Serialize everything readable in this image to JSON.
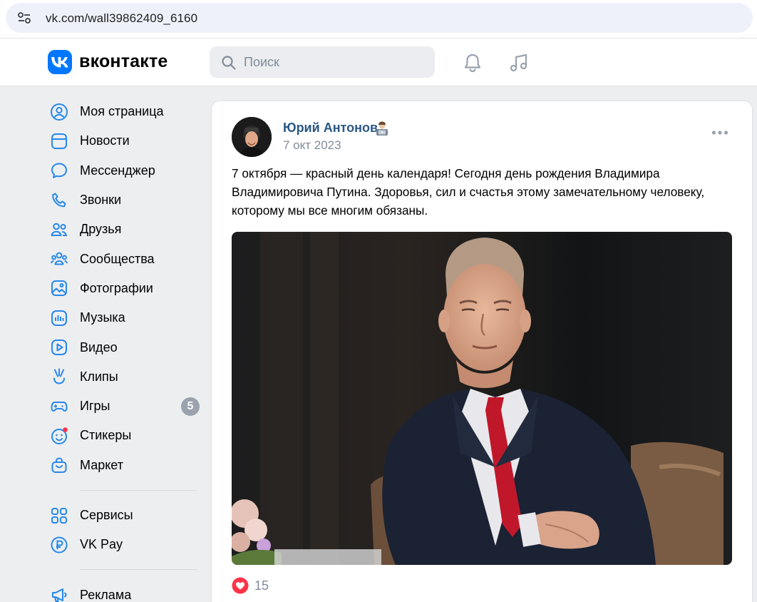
{
  "browser": {
    "url": "vk.com/wall39862409_6160"
  },
  "header": {
    "brand": "вконтакте",
    "search_placeholder": "Поиск",
    "icons": [
      "site-settings-icon",
      "vk-logo-icon",
      "search-icon",
      "bell-icon",
      "music-note-icon"
    ]
  },
  "sidebar": {
    "items": [
      {
        "label": "Моя страница",
        "icon": "user-circle-icon"
      },
      {
        "label": "Новости",
        "icon": "news-icon"
      },
      {
        "label": "Мессенджер",
        "icon": "message-bubble-icon"
      },
      {
        "label": "Звонки",
        "icon": "phone-icon"
      },
      {
        "label": "Друзья",
        "icon": "friends-icon"
      },
      {
        "label": "Сообщества",
        "icon": "communities-icon"
      },
      {
        "label": "Фотографии",
        "icon": "photo-icon"
      },
      {
        "label": "Музыка",
        "icon": "music-icon"
      },
      {
        "label": "Видео",
        "icon": "video-icon"
      },
      {
        "label": "Клипы",
        "icon": "clips-icon"
      },
      {
        "label": "Игры",
        "icon": "gamepad-icon",
        "badge": "5"
      },
      {
        "label": "Стикеры",
        "icon": "sticker-icon"
      },
      {
        "label": "Маркет",
        "icon": "market-bag-icon"
      }
    ],
    "services": [
      {
        "label": "Сервисы",
        "icon": "services-grid-icon"
      },
      {
        "label": "VK Pay",
        "icon": "ruble-icon"
      }
    ],
    "extra": [
      {
        "label": "Реклама",
        "icon": "megaphone-icon"
      }
    ]
  },
  "post": {
    "author": "Юрий Антонов",
    "date": "7 окт 2023",
    "text": "7 октября — красный день календаря! Сегодня день рождения Владимира Владимировича Путина. Здоровья, сил и счастья этому замечательному человеку, которому мы все многим обязаны.",
    "likes": "15"
  },
  "colors": {
    "accent": "#0077ff",
    "link": "#2a5885",
    "badge": "#99a2ad",
    "like": "#ff3347",
    "background": "#edeef0"
  }
}
